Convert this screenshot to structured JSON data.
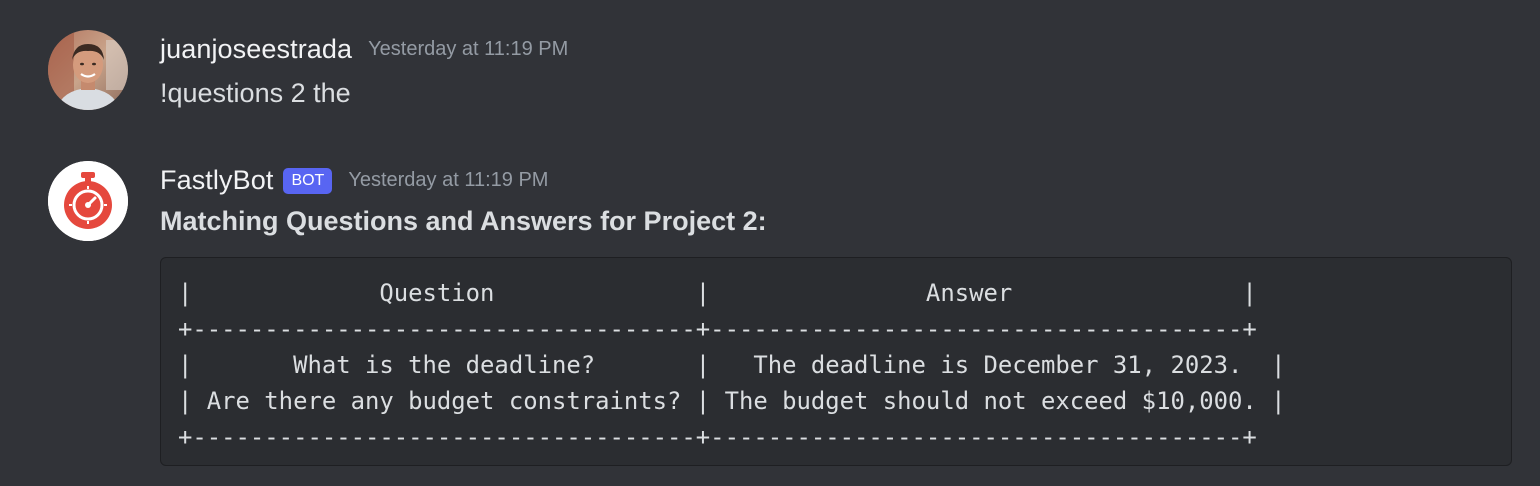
{
  "messages": [
    {
      "username": "juanjoseestrada",
      "timestamp": "Yesterday at 11:19 PM",
      "text": "!questions 2 the",
      "avatar": "user-photo-avatar"
    },
    {
      "username": "FastlyBot",
      "badge": "BOT",
      "timestamp": "Yesterday at 11:19 PM",
      "title": "Matching Questions and Answers for Project 2:",
      "avatar": "stopwatch-icon",
      "code_lines": [
        "|             Question              |               Answer                |",
        "+-----------------------------------+-------------------------------------+",
        "|       What is the deadline?       |   The deadline is December 31, 2023.  |",
        "| Are there any budget constraints? | The budget should not exceed $10,000. |",
        "+-----------------------------------+-------------------------------------+"
      ]
    }
  ],
  "colors": {
    "background": "#313338",
    "codeblock_bg": "#2b2d31",
    "bot_badge": "#5865f2",
    "bot_avatar_red": "#e5483d"
  }
}
